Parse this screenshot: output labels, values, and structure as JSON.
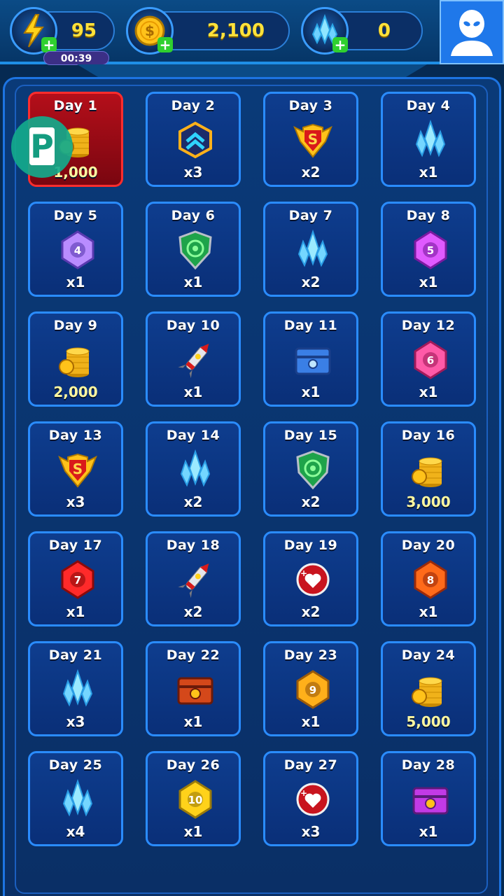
{
  "hud": {
    "energy": {
      "value": "95",
      "icon": "lightning-icon",
      "timer": "00:39"
    },
    "coins": {
      "value": "2,100",
      "icon": "coin-icon"
    },
    "crystals": {
      "value": "0",
      "icon": "crystal-icon"
    },
    "profile_icon": "alien-avatar-icon"
  },
  "colors": {
    "accent": "#2a8cff",
    "selected": "#b40f1a",
    "value_text": "#ffe23a"
  },
  "rewards": [
    {
      "day": "Day 1",
      "amount": "1,000",
      "icon": "coin-stack-icon",
      "selected": true
    },
    {
      "day": "Day 2",
      "amount": "x3",
      "icon": "chevron-badge-icon"
    },
    {
      "day": "Day 3",
      "amount": "x2",
      "icon": "s-shield-icon"
    },
    {
      "day": "Day 4",
      "amount": "x1",
      "icon": "crystal-icon"
    },
    {
      "day": "Day 5",
      "amount": "x1",
      "icon": "gem-4-icon"
    },
    {
      "day": "Day 6",
      "amount": "x1",
      "icon": "green-shield-icon"
    },
    {
      "day": "Day 7",
      "amount": "x2",
      "icon": "crystal-icon"
    },
    {
      "day": "Day 8",
      "amount": "x1",
      "icon": "gem-5-icon"
    },
    {
      "day": "Day 9",
      "amount": "2,000",
      "icon": "coin-stack-icon"
    },
    {
      "day": "Day 10",
      "amount": "x1",
      "icon": "missile-icon"
    },
    {
      "day": "Day 11",
      "amount": "x1",
      "icon": "blue-chest-icon"
    },
    {
      "day": "Day 12",
      "amount": "x1",
      "icon": "gem-6-icon"
    },
    {
      "day": "Day 13",
      "amount": "x3",
      "icon": "s-shield-icon"
    },
    {
      "day": "Day 14",
      "amount": "x2",
      "icon": "crystal-icon"
    },
    {
      "day": "Day 15",
      "amount": "x2",
      "icon": "green-shield-icon"
    },
    {
      "day": "Day 16",
      "amount": "3,000",
      "icon": "coin-stack-icon"
    },
    {
      "day": "Day 17",
      "amount": "x1",
      "icon": "gem-7-icon"
    },
    {
      "day": "Day 18",
      "amount": "x2",
      "icon": "missile-icon"
    },
    {
      "day": "Day 19",
      "amount": "x2",
      "icon": "heart-plus-icon"
    },
    {
      "day": "Day 20",
      "amount": "x1",
      "icon": "gem-8-icon"
    },
    {
      "day": "Day 21",
      "amount": "x3",
      "icon": "crystal-icon"
    },
    {
      "day": "Day 22",
      "amount": "x1",
      "icon": "red-chest-icon"
    },
    {
      "day": "Day 23",
      "amount": "x1",
      "icon": "gem-9-icon"
    },
    {
      "day": "Day 24",
      "amount": "5,000",
      "icon": "coin-stack-icon"
    },
    {
      "day": "Day 25",
      "amount": "x4",
      "icon": "crystal-icon"
    },
    {
      "day": "Day 26",
      "amount": "x1",
      "icon": "gem-10-icon"
    },
    {
      "day": "Day 27",
      "amount": "x3",
      "icon": "heart-plus-icon"
    },
    {
      "day": "Day 28",
      "amount": "x1",
      "icon": "purple-chest-icon"
    }
  ],
  "overlay_badge": {
    "letter": "P",
    "icon": "p-badge-icon"
  }
}
